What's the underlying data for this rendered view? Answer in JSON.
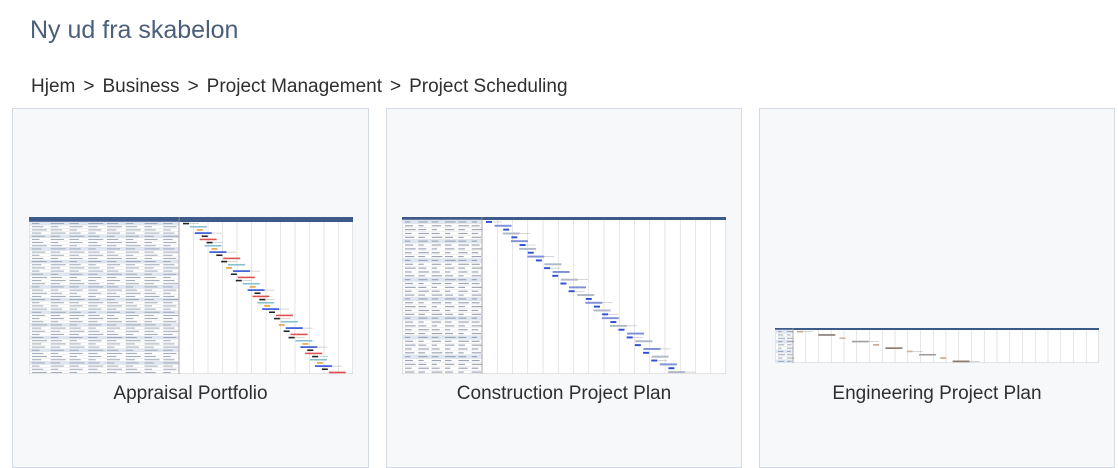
{
  "page": {
    "title": "Ny ud fra skabelon"
  },
  "breadcrumb": {
    "items": [
      "Hjem",
      "Business",
      "Project Management",
      "Project Scheduling"
    ],
    "separator": ">"
  },
  "templates": [
    {
      "label": "Appraisal Portfolio"
    },
    {
      "label": "Construction Project Plan"
    },
    {
      "label": "Engineering Project Plan"
    }
  ],
  "colors": {
    "title": "#4a5f7a",
    "card_border": "#d3dae6",
    "card_bg": "#f7f8fa",
    "gantt_header": "#3d5a8a",
    "gantt_bar_blue": "#2f4fd6",
    "gantt_bar_dark": "#222222",
    "gantt_bar_red": "#e05050",
    "gantt_bar_orange": "#e8a040"
  }
}
